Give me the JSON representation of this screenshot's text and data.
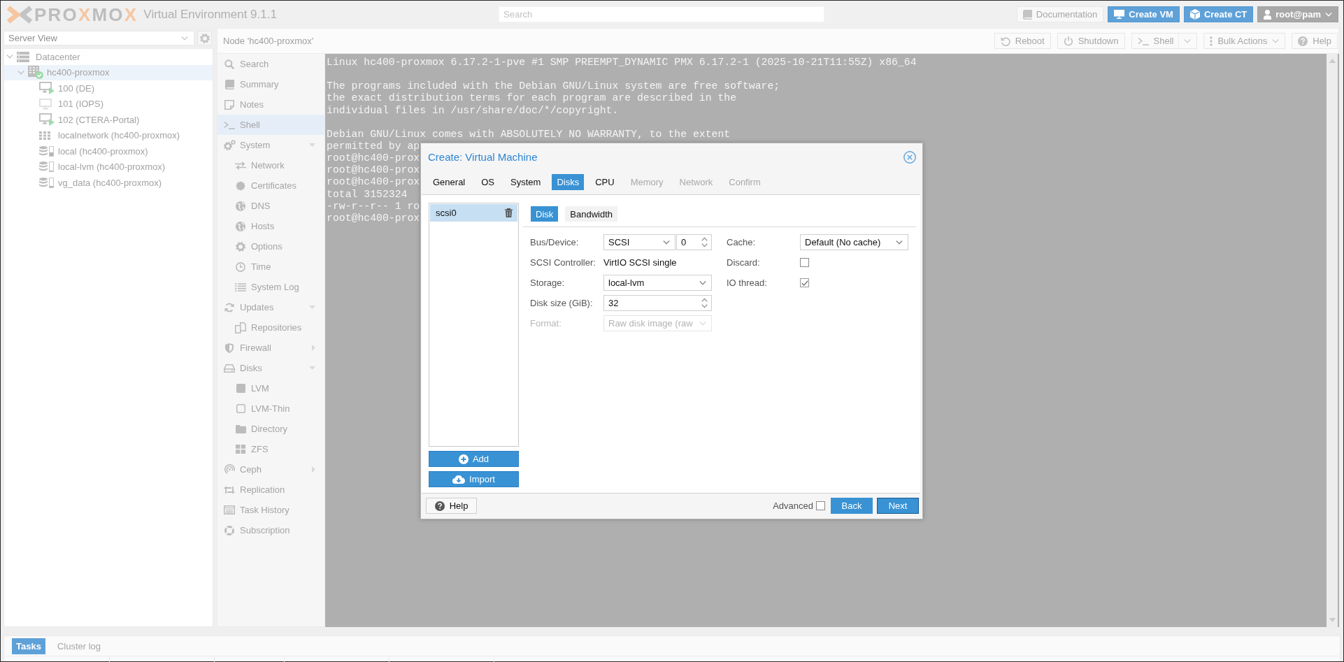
{
  "header": {
    "logo": "PRO**X**MO**X**",
    "product": "Virtual Environment 9.1.1",
    "search": {
      "placeholder": "Search"
    },
    "buttons": [
      {
        "label": "Documentation",
        "kind": "plain"
      },
      {
        "label": "Create VM",
        "kind": "primary"
      },
      {
        "label": "Create CT",
        "kind": "primary"
      }
    ],
    "user": {
      "label": "root@pam"
    }
  },
  "sidebar": {
    "view": {
      "value": "Server View"
    },
    "tree": [
      {
        "label": "Datacenter",
        "kind": "datacenter",
        "selected": false,
        "expanded": true,
        "children": [
          {
            "label": "hc400-proxmox",
            "kind": "node",
            "online": true,
            "selected": true,
            "expanded": true,
            "children": [
              {
                "label": "100 (DE)",
                "kind": "vm",
                "running": true,
                "selected": false
              },
              {
                "label": "101 (IOPS)",
                "kind": "vm",
                "running": false,
                "selected": false
              },
              {
                "label": "102 (CTERA-Portal)",
                "kind": "vm",
                "running": true,
                "selected": false
              },
              {
                "label": "localnetwork (hc400-proxmox)",
                "kind": "sdn",
                "selected": false
              },
              {
                "label": "local (hc400-proxmox)",
                "kind": "storage",
                "level": 0.4,
                "selected": false
              },
              {
                "label": "local-lvm (hc400-proxmox)",
                "kind": "storage",
                "level": 0.1,
                "selected": false
              },
              {
                "label": "vg_data (hc400-proxmox)",
                "kind": "storage",
                "level": 0.1,
                "selected": false
              }
            ]
          }
        ]
      }
    ]
  },
  "node": {
    "title": "Node 'hc400-proxmox'",
    "toolbar": [
      {
        "label": "Reboot",
        "kind": "button"
      },
      {
        "label": "Shutdown",
        "kind": "button"
      },
      {
        "label": "Shell",
        "kind": "split"
      },
      {
        "label": "Bulk Actions",
        "kind": "menu"
      },
      {
        "label": "Help",
        "kind": "button"
      }
    ],
    "menu": [
      {
        "label": "Search",
        "selected": false
      },
      {
        "label": "Summary",
        "selected": false
      },
      {
        "label": "Notes",
        "selected": false
      },
      {
        "label": "Shell",
        "selected": true
      },
      {
        "label": "System",
        "selected": false,
        "expanded": true,
        "children": [
          {
            "label": "Network",
            "selected": false
          },
          {
            "label": "Certificates",
            "selected": false
          },
          {
            "label": "DNS",
            "selected": false
          },
          {
            "label": "Hosts",
            "selected": false
          },
          {
            "label": "Options",
            "selected": false
          },
          {
            "label": "Time",
            "selected": false
          },
          {
            "label": "System Log",
            "selected": false
          }
        ]
      },
      {
        "label": "Updates",
        "selected": false,
        "expanded": true,
        "children": [
          {
            "label": "Repositories",
            "selected": false
          }
        ]
      },
      {
        "label": "Firewall",
        "selected": false,
        "expanded": false
      },
      {
        "label": "Disks",
        "selected": false,
        "expanded": true,
        "children": [
          {
            "label": "LVM",
            "selected": false
          },
          {
            "label": "LVM-Thin",
            "selected": false
          },
          {
            "label": "Directory",
            "selected": false
          },
          {
            "label": "ZFS",
            "selected": false
          }
        ]
      },
      {
        "label": "Ceph",
        "selected": false,
        "expanded": false
      },
      {
        "label": "Replication",
        "selected": false
      },
      {
        "label": "Task History",
        "selected": false
      },
      {
        "label": "Subscription",
        "selected": false
      }
    ],
    "terminal": {
      "blocks": [
        [
          "Linux hc400-proxmox 6.17.2-1-pve #1 SMP PREEMPT_DYNAMIC PMX 6.17.2-1 (2025-10-21T11:55Z) x86_64"
        ],
        [
          "The programs included with the Debian GNU/Linux system are free software;",
          "the exact distribution terms for each program are described in the",
          "individual files in /usr/share/doc/*/copyright."
        ],
        [
          "Debian GNU/Linux comes with ABSOLUTELY NO WARRANTY, to the extent",
          "permitted by ap",
          "root@hc400-prox",
          "root@hc400-prox",
          "root@hc400-prox",
          "total 3152324",
          "-rw-r--r-- 1 ro",
          "root@hc400-prox"
        ]
      ]
    }
  },
  "dialog": {
    "title": "Create: Virtual Machine",
    "tabs": [
      {
        "label": "General",
        "selected": false,
        "disabled": false
      },
      {
        "label": "OS",
        "selected": false,
        "disabled": false
      },
      {
        "label": "System",
        "selected": false,
        "disabled": false
      },
      {
        "label": "Disks",
        "selected": true,
        "disabled": false
      },
      {
        "label": "CPU",
        "selected": false,
        "disabled": false
      },
      {
        "label": "Memory",
        "selected": false,
        "disabled": true
      },
      {
        "label": "Network",
        "selected": false,
        "disabled": true
      },
      {
        "label": "Confirm",
        "selected": false,
        "disabled": true
      }
    ],
    "disks": [
      {
        "label": "scsi0",
        "selected": true
      }
    ],
    "add_button": "Add",
    "import_button": "Import",
    "subtabs": [
      {
        "label": "Disk",
        "selected": true
      },
      {
        "label": "Bandwidth",
        "selected": false
      }
    ],
    "fields_left": [
      {
        "label": "Bus/Device:",
        "kind": "bus",
        "value": "SCSI",
        "number": "0",
        "disabled": false
      },
      {
        "label": "SCSI Controller:",
        "kind": "text",
        "value": "VirtIO SCSI single",
        "disabled": false
      },
      {
        "label": "Storage:",
        "kind": "combo",
        "value": "local-lvm",
        "disabled": false
      },
      {
        "label": "Disk size (GiB):",
        "kind": "spinner",
        "value": "32",
        "disabled": false
      },
      {
        "label": "Format:",
        "kind": "combo",
        "value": "Raw disk image (raw",
        "disabled": true
      }
    ],
    "fields_right": [
      {
        "label": "Cache:",
        "kind": "combo",
        "value": "Default (No cache)"
      },
      {
        "label": "Discard:",
        "kind": "checkbox",
        "checked": false
      },
      {
        "label": "IO thread:",
        "kind": "checkbox",
        "checked": true
      }
    ],
    "footer": {
      "help": "Help",
      "advanced": {
        "label": "Advanced",
        "checked": false
      },
      "buttons": [
        {
          "label": "Back",
          "focused": false
        },
        {
          "label": "Next",
          "focused": true
        }
      ]
    }
  },
  "bottom": {
    "tabs": [
      {
        "label": "Tasks",
        "selected": true
      },
      {
        "label": "Cluster log",
        "selected": false
      }
    ]
  }
}
